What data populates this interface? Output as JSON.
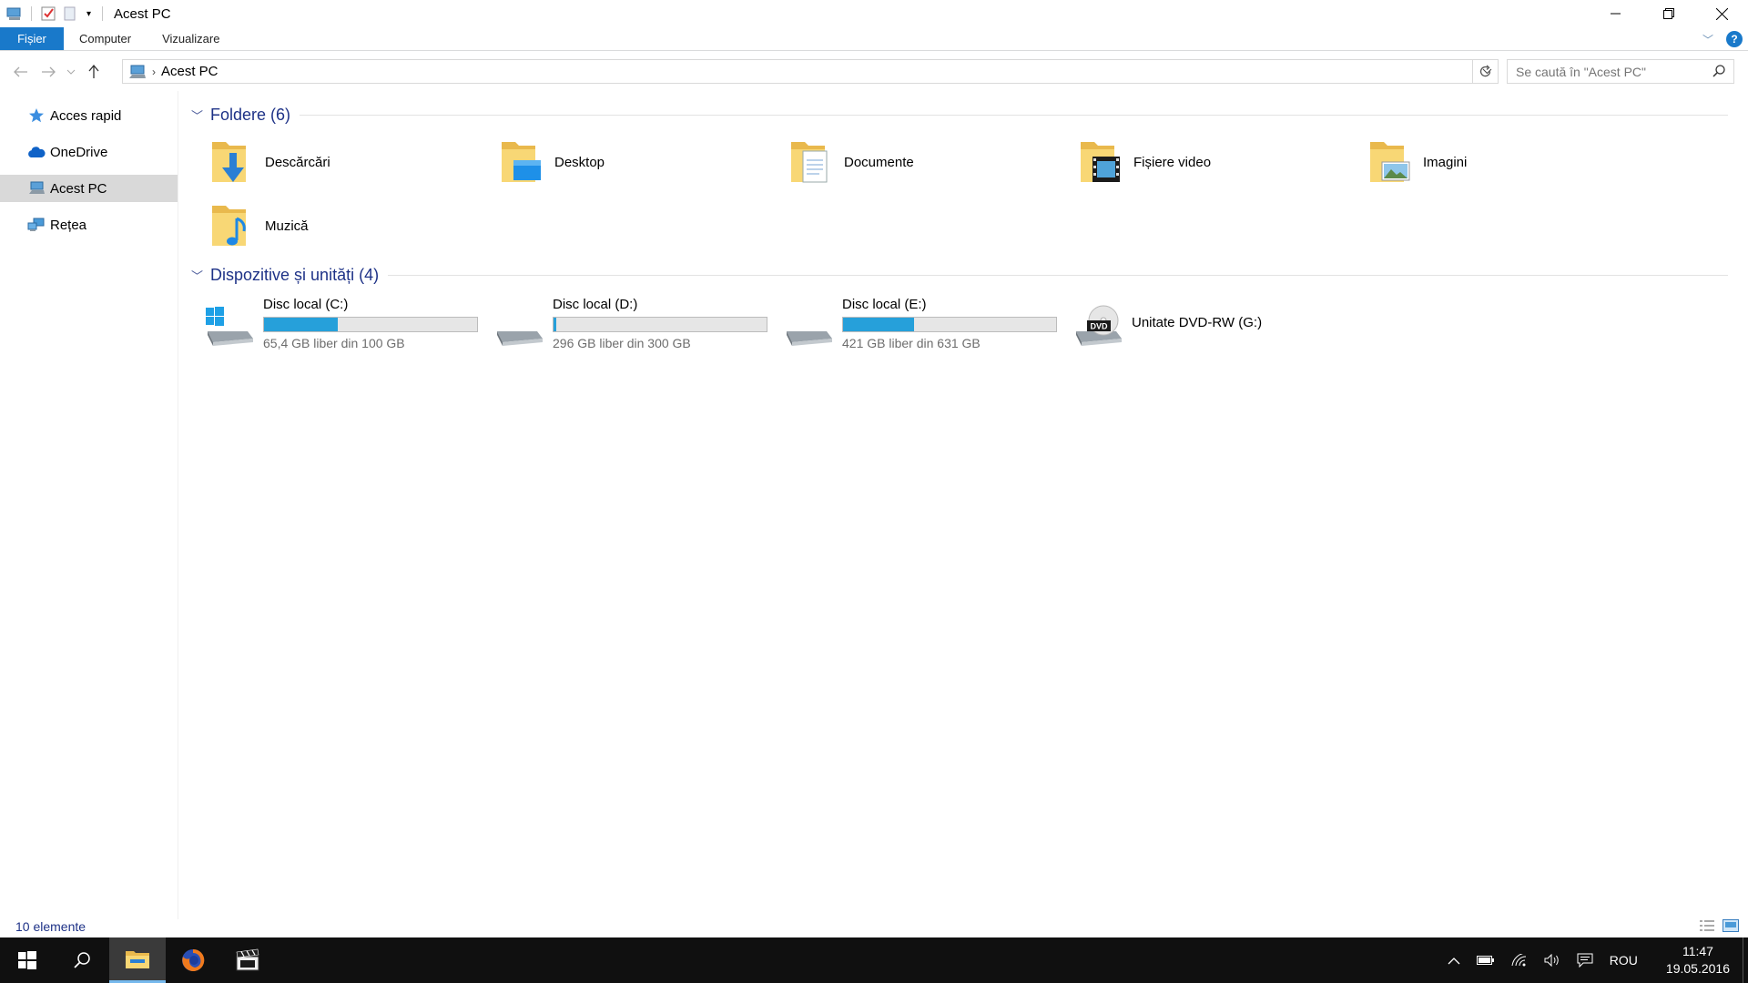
{
  "window": {
    "title": "Acest PC"
  },
  "ribbon": {
    "tabs": [
      "Fișier",
      "Computer",
      "Vizualizare"
    ],
    "help": "?"
  },
  "address": {
    "path": "Acest PC",
    "search_placeholder": "Se caută în \"Acest PC\""
  },
  "nav": {
    "items": [
      {
        "label": "Acces rapid",
        "icon": "star-icon"
      },
      {
        "label": "OneDrive",
        "icon": "cloud-icon"
      },
      {
        "label": "Acest PC",
        "icon": "computer-icon",
        "selected": true
      },
      {
        "label": "Rețea",
        "icon": "network-icon"
      }
    ]
  },
  "groups": {
    "folders": {
      "title": "Foldere (6)"
    },
    "devices": {
      "title": "Dispozitive și unități (4)"
    }
  },
  "folders": [
    {
      "label": "Descărcări",
      "icon": "downloads-folder-icon"
    },
    {
      "label": "Desktop",
      "icon": "desktop-folder-icon"
    },
    {
      "label": "Documente",
      "icon": "documents-folder-icon"
    },
    {
      "label": "Fișiere video",
      "icon": "videos-folder-icon"
    },
    {
      "label": "Imagini",
      "icon": "pictures-folder-icon"
    },
    {
      "label": "Muzică",
      "icon": "music-folder-icon"
    }
  ],
  "drives": [
    {
      "name": "Disc local (C:)",
      "free": "65,4 GB liber din 100 GB",
      "used_fraction": 0.346,
      "icon": "windows-drive-icon"
    },
    {
      "name": "Disc local (D:)",
      "free": "296 GB liber din 300 GB",
      "used_fraction": 0.013,
      "icon": "hard-drive-icon"
    },
    {
      "name": "Disc local (E:)",
      "free": "421 GB liber din 631 GB",
      "used_fraction": 0.333,
      "icon": "hard-drive-icon"
    },
    {
      "name": "Unitate DVD-RW (G:)",
      "icon": "dvd-drive-icon",
      "dvd_label": "DVD"
    }
  ],
  "status": {
    "count": "10 elemente"
  },
  "taskbar": {
    "lang": "ROU",
    "time": "11:47",
    "date": "19.05.2016"
  },
  "colors": {
    "accent": "#1979ca",
    "bar_fill": "#26a0da",
    "group_title": "#1e3287",
    "folder_yellow": "#f8d775"
  }
}
